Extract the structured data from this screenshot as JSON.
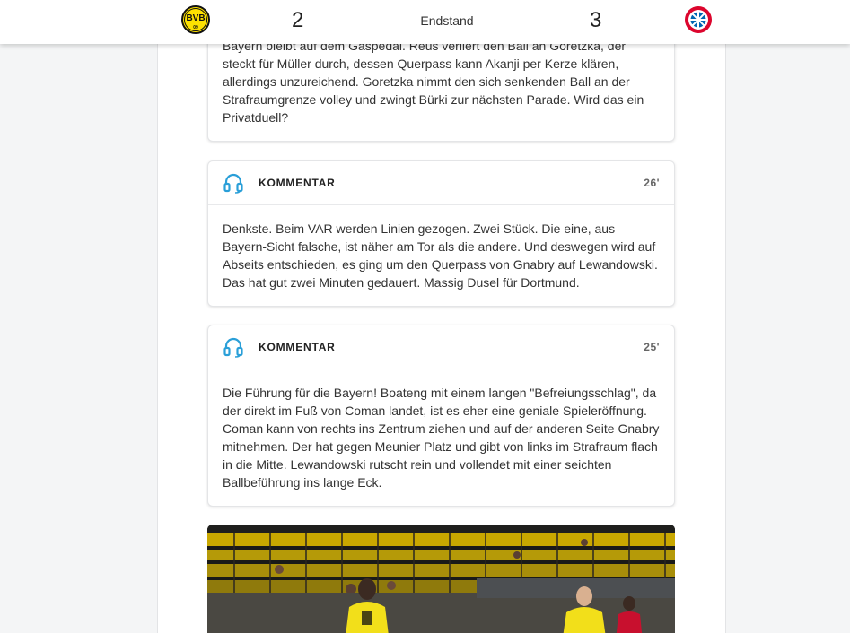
{
  "scoreboard": {
    "home_team_logo": "bvb-logo-icon",
    "away_team_logo": "fc-bayern-logo-icon",
    "home_score": "2",
    "away_score": "3",
    "status": "Endstand"
  },
  "ticker": [
    {
      "text": "Bayern bleibt auf dem Gaspedal. Reus verliert den Ball an Goretzka, der steckt für Müller durch, dessen Querpass kann Akanji per Kerze klären, allerdings unzureichend. Goretzka nimmt den sich senkenden Ball an der Strafraumgrenze volley und zwingt Bürki zur nächsten Parade. Wird das ein Privatduell?"
    },
    {
      "kind": "KOMMENTAR",
      "minute": "26'",
      "icon": "headset-icon",
      "text": "Denkste. Beim VAR werden Linien gezogen. Zwei Stück. Die eine, aus Bayern-Sicht falsche, ist näher am Tor als die andere. Und deswegen wird auf Abseits entschieden, es ging um den Querpass von Gnabry auf Lewandowski. Das hat gut zwei Minuten gedauert. Massig Dusel für Dortmund."
    },
    {
      "kind": "KOMMENTAR",
      "minute": "25'",
      "icon": "headset-icon",
      "text": "Die Führung für die Bayern! Boateng mit einem langen \"Befreiungsschlag\", da der direkt im Fuß von Coman landet, ist es eher eine geniale Spieleröffnung. Coman kann von rechts ins Zentrum ziehen und auf der anderen Seite Gnabry mitnehmen. Der hat gegen Meunier Platz und gibt von links im Strafraum flach in die Mitte. Lewandowski rutscht rein und vollendet mit einer seichten Ballbeführung ins lange Eck."
    }
  ],
  "colors": {
    "accent": "#2a9fd8",
    "bvb_yellow": "#fde100",
    "bayern_red": "#dc052d"
  }
}
